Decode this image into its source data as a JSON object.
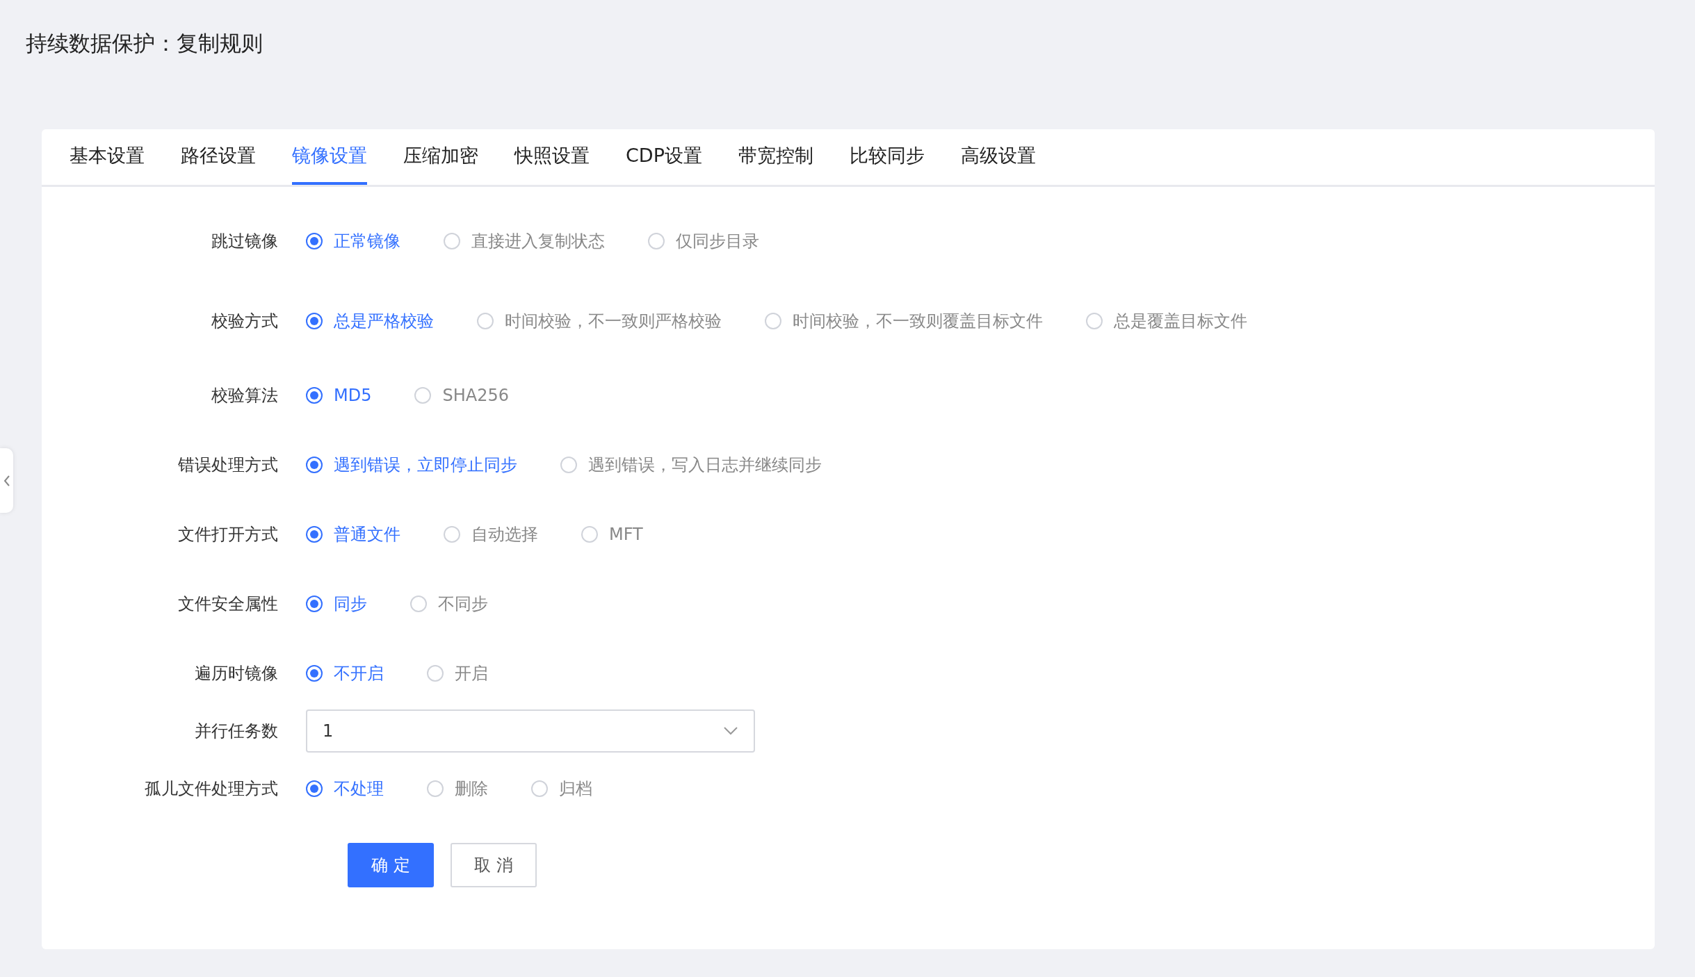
{
  "page_title": "持续数据保护：复制规则",
  "tabs": [
    {
      "label": "基本设置",
      "selected": false
    },
    {
      "label": "路径设置",
      "selected": false
    },
    {
      "label": "镜像设置",
      "selected": true
    },
    {
      "label": "压缩加密",
      "selected": false
    },
    {
      "label": "快照设置",
      "selected": false
    },
    {
      "label": "CDP设置",
      "selected": false
    },
    {
      "label": "带宽控制",
      "selected": false
    },
    {
      "label": "比较同步",
      "selected": false
    },
    {
      "label": "高级设置",
      "selected": false
    }
  ],
  "form": [
    {
      "kind": "radio",
      "label": "跳过镜像",
      "options": [
        {
          "label": "正常镜像",
          "selected": true
        },
        {
          "label": "直接进入复制状态",
          "selected": false
        },
        {
          "label": "仅同步目录",
          "selected": false
        }
      ]
    },
    {
      "kind": "radio",
      "label": "校验方式",
      "options": [
        {
          "label": "总是严格校验",
          "selected": true
        },
        {
          "label": "时间校验，不一致则严格校验",
          "selected": false
        },
        {
          "label": "时间校验，不一致则覆盖目标文件",
          "selected": false
        },
        {
          "label": "总是覆盖目标文件",
          "selected": false
        }
      ]
    },
    {
      "kind": "radio",
      "label": "校验算法",
      "options": [
        {
          "label": "MD5",
          "selected": true
        },
        {
          "label": "SHA256",
          "selected": false
        }
      ]
    },
    {
      "kind": "radio",
      "label": "错误处理方式",
      "options": [
        {
          "label": "遇到错误，立即停止同步",
          "selected": true
        },
        {
          "label": "遇到错误，写入日志并继续同步",
          "selected": false
        }
      ]
    },
    {
      "kind": "radio",
      "label": "文件打开方式",
      "options": [
        {
          "label": "普通文件",
          "selected": true
        },
        {
          "label": "自动选择",
          "selected": false
        },
        {
          "label": "MFT",
          "selected": false
        }
      ]
    },
    {
      "kind": "radio",
      "label": "文件安全属性",
      "options": [
        {
          "label": "同步",
          "selected": true
        },
        {
          "label": "不同步",
          "selected": false
        }
      ]
    },
    {
      "kind": "radio",
      "label": "遍历时镜像",
      "options": [
        {
          "label": "不开启",
          "selected": true
        },
        {
          "label": "开启",
          "selected": false
        }
      ]
    },
    {
      "kind": "select",
      "label": "并行任务数",
      "value": "1"
    },
    {
      "kind": "radio",
      "label": "孤儿文件处理方式",
      "options": [
        {
          "label": "不处理",
          "selected": true
        },
        {
          "label": "删除",
          "selected": false
        },
        {
          "label": "归档",
          "selected": false
        }
      ]
    }
  ],
  "buttons": [
    {
      "kind": "primary",
      "label": "确 定"
    },
    {
      "kind": "default",
      "label": "取 消"
    }
  ]
}
